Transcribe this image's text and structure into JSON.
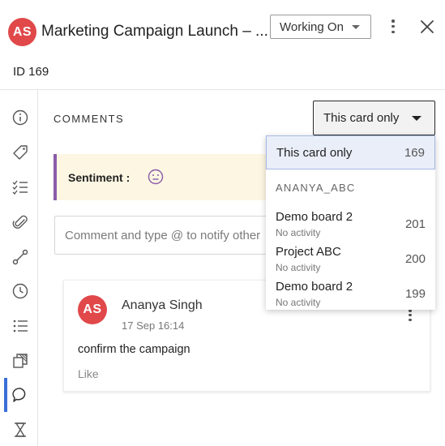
{
  "header": {
    "avatar_initials": "AS",
    "title": "Marketing Campaign Launch – ...",
    "status_label": "Working On"
  },
  "card_id_label": "ID 169",
  "comments": {
    "section_title": "COMMENTS",
    "filter_label": "This card only",
    "sentiment_label": "Sentiment :",
    "input_placeholder": "Comment and type @ to notify other",
    "items": [
      {
        "avatar_initials": "AS",
        "author": "Ananya Singh",
        "timestamp": "17 Sep 16:14",
        "text": "confirm the campaign",
        "like_label": "Like"
      }
    ]
  },
  "dropdown": {
    "selected": {
      "name": "This card only",
      "count": "169"
    },
    "group_label": "ANANYA_ABC",
    "items": [
      {
        "name": "Demo board 2",
        "sub": "No activity",
        "count": "201"
      },
      {
        "name": "Project ABC",
        "sub": "No activity",
        "count": "200"
      },
      {
        "name": "Demo board 2",
        "sub": "No activity",
        "count": "199"
      }
    ]
  },
  "sidebar": {
    "icons": [
      "info-icon",
      "tag-icon",
      "checklist-icon",
      "attachment-icon",
      "dependency-icon",
      "clock-icon",
      "list-icon",
      "copy-icon",
      "comment-icon",
      "hourglass-icon"
    ],
    "active": "comment-icon"
  },
  "colors": {
    "avatar": "#e0484a",
    "active_indicator": "#3a6fd8",
    "sentiment_bg": "#fcf6e2",
    "sentiment_accent": "#8b5ba8",
    "dropdown_selected_bg": "#e9eef9"
  }
}
